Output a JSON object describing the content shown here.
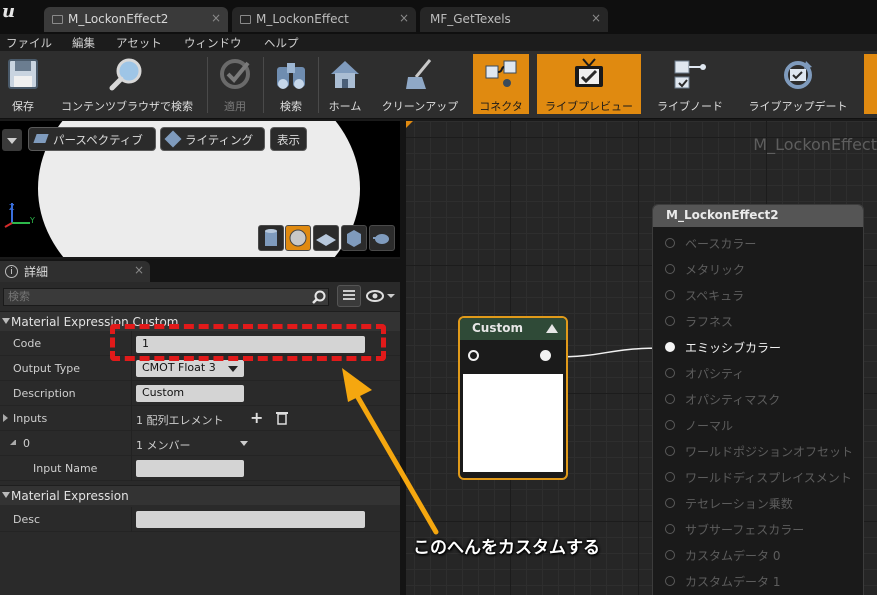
{
  "tabs": [
    {
      "label": "M_LockonEffect2",
      "active": true
    },
    {
      "label": "M_LockonEffect",
      "active": false
    },
    {
      "label": "MF_GetTexels",
      "active": false
    }
  ],
  "tab_close_glyph": "×",
  "menu": [
    "ファイル",
    "編集",
    "アセット",
    "ウィンドウ",
    "ヘルプ"
  ],
  "toolbar": [
    {
      "label": "保存",
      "icon": "save-icon"
    },
    {
      "label": "コンテンツブラウザで検索",
      "icon": "magnifier-icon"
    },
    {
      "label": "適用",
      "icon": "apply-check-icon",
      "disabled": true
    },
    {
      "label": "検索",
      "icon": "binoculars-icon"
    },
    {
      "label": "ホーム",
      "icon": "home-icon"
    },
    {
      "label": "クリーンアップ",
      "icon": "broom-icon"
    },
    {
      "label": "コネクタ",
      "icon": "connector-icon",
      "active": true
    },
    {
      "label": "ライブプレビュー",
      "icon": "tv-icon",
      "active": true
    },
    {
      "label": "ライブノード",
      "icon": "live-node-icon"
    },
    {
      "label": "ライブアップデート",
      "icon": "live-update-icon"
    }
  ],
  "viewport": {
    "perspective_label": "パースペクティブ",
    "lighting_label": "ライティング",
    "show_label": "表示",
    "axis_labels": {
      "z": "Z",
      "y": "Y"
    }
  },
  "details": {
    "tab_label": "詳細",
    "search_placeholder": "検索",
    "section1_title": "Material Expression Custom",
    "rows": {
      "code": {
        "label": "Code",
        "value": "1"
      },
      "output_type": {
        "label": "Output Type",
        "value": "CMOT Float 3"
      },
      "description": {
        "label": "Description",
        "value": "Custom"
      },
      "inputs": {
        "label": "Inputs",
        "value": "1 配列エレメント"
      },
      "input0": {
        "label": "0",
        "value": "1 メンバー"
      },
      "input_name": {
        "label": "Input Name",
        "value": ""
      }
    },
    "section2_title": "Material Expression",
    "desc": {
      "label": "Desc",
      "value": ""
    }
  },
  "graph": {
    "title": "M_LockonEffect",
    "custom_node_title": "Custom",
    "result_node_title": "M_LockonEffect2",
    "pins": [
      {
        "label": "ベースカラー",
        "active": false
      },
      {
        "label": "メタリック",
        "active": false
      },
      {
        "label": "スペキュラ",
        "active": false
      },
      {
        "label": "ラフネス",
        "active": false
      },
      {
        "label": "エミッシブカラー",
        "active": true
      },
      {
        "label": "オパシティ",
        "active": false
      },
      {
        "label": "オパシティマスク",
        "active": false
      },
      {
        "label": "ノーマル",
        "active": false
      },
      {
        "label": "ワールドポジションオフセット",
        "active": false
      },
      {
        "label": "ワールドディスプレイスメント",
        "active": false
      },
      {
        "label": "テセレーション乗数",
        "active": false
      },
      {
        "label": "サブサーフェスカラー",
        "active": false
      },
      {
        "label": "カスタムデータ 0",
        "active": false
      },
      {
        "label": "カスタムデータ 1",
        "active": false
      }
    ]
  },
  "annotation": {
    "text": "このへんをカスタムする",
    "box_color": "#e11a1a",
    "arrow_color": "#f5a70f"
  },
  "colors": {
    "accent": "#e08a10",
    "node_outline": "#e09a1a",
    "custom_header": "#2f4a37"
  }
}
